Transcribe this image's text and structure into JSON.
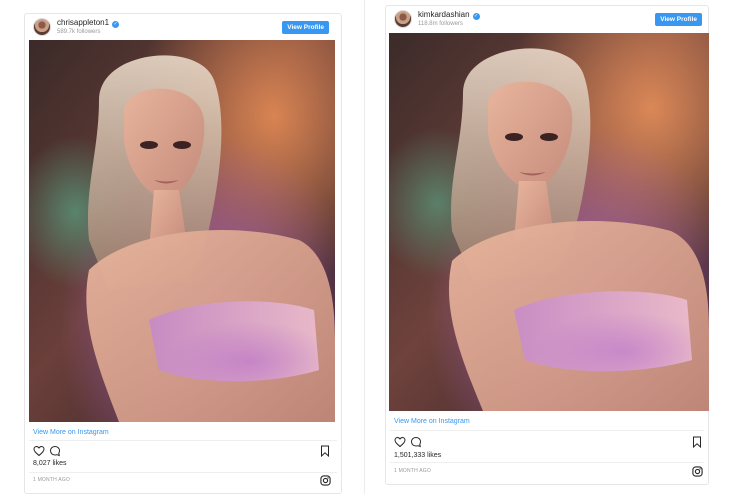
{
  "posts": [
    {
      "username": "chrisappleton1",
      "followers": "589.7k followers",
      "view_profile": "View Profile",
      "view_more": "View More on Instagram",
      "likes": "8,027 likes",
      "timestamp": "1 MONTH AGO"
    },
    {
      "username": "kimkardashian",
      "followers": "118.8m followers",
      "view_profile": "View Profile",
      "view_more": "View More on Instagram",
      "likes": "1,501,333 likes",
      "timestamp": "1 MONTH AGO"
    }
  ],
  "icons": {
    "verified": "verified-badge-icon",
    "like": "heart-icon",
    "comment": "comment-icon",
    "save": "bookmark-icon",
    "instagram": "instagram-logo-icon"
  },
  "colors": {
    "accent": "#3897f0",
    "text": "#262626",
    "muted": "#999999",
    "border": "#e6e6e6"
  }
}
